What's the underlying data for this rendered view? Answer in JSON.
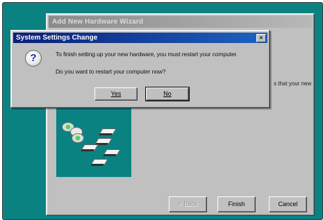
{
  "wizard": {
    "title": "Add New Hardware Wizard",
    "partial_text": "s that your new",
    "buttons": {
      "back": "< Back",
      "finish": "Finish",
      "cancel": "Cancel"
    }
  },
  "dialog": {
    "title": "System Settings Change",
    "close": "×",
    "icon": "question-icon",
    "message_line1": "To finish setting up your new hardware, you must restart your computer.",
    "message_line2": "Do you want to restart your computer now?",
    "buttons": {
      "yes": "Yes",
      "no": "No"
    }
  },
  "colors": {
    "desktop": "#0a8282",
    "titlebar_active": "#0a1f78",
    "window_face": "#c0c0c0"
  }
}
